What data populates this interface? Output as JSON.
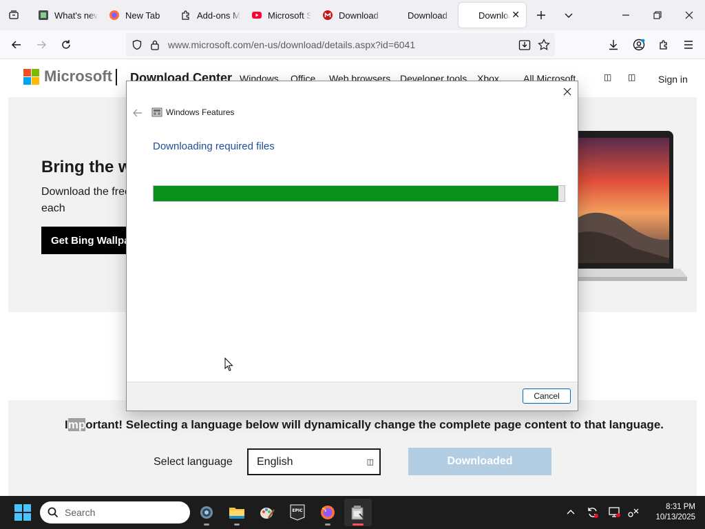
{
  "browser": {
    "tabs": [
      {
        "label": "What's new",
        "icon": "notepad-app-icon"
      },
      {
        "label": "New Tab",
        "icon": "firefox-icon"
      },
      {
        "label": "Add-ons M",
        "icon": "puzzle-icon"
      },
      {
        "label": "Microsoft S",
        "icon": "youtube-icon"
      },
      {
        "label": "Download",
        "icon": "mcafee-icon"
      },
      {
        "label": "Download",
        "icon": "none"
      },
      {
        "label": "Downloa",
        "icon": "none",
        "active": true
      }
    ],
    "url": "www.microsoft.com/en-us/download/details.aspx?id=6041",
    "accent": "#0061e0"
  },
  "site": {
    "brand": "Microsoft",
    "section_title": "Download Center",
    "nav": [
      "Windows",
      "Office",
      "Web browsers",
      "Developer tools",
      "Xbox"
    ],
    "all_microsoft": "All Microsoft",
    "sign_in": "Sign in",
    "hero": {
      "title": "Bring the w",
      "description": "Download the free background each",
      "button": "Get Bing Wallpa"
    },
    "language": {
      "important_prefix": "I",
      "important_selected": "mp",
      "important_rest": "ortant! Selecting a language below will dynamically change the complete page content to that language.",
      "label": "Select language",
      "selected": "English",
      "download_button": "Downloaded"
    }
  },
  "dialog": {
    "title": "Windows Features",
    "heading": "Downloading required files",
    "progress": 0.985,
    "progress_color": "#0a8f1a",
    "cancel": "Cancel"
  },
  "taskbar": {
    "search_placeholder": "Search",
    "apps": [
      "settings-icon",
      "file-explorer-icon",
      "paint-icon",
      "epic-games-icon",
      "firefox-icon",
      "installer-icon"
    ],
    "time": "8:31 PM",
    "date": "10/13/2025"
  }
}
